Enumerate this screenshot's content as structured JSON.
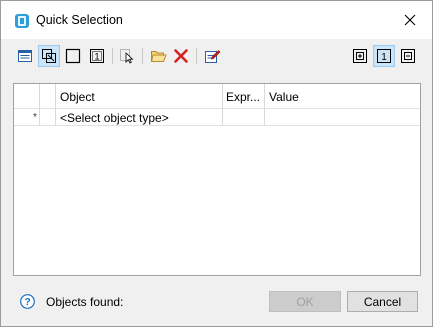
{
  "window": {
    "title": "Quick Selection"
  },
  "toolbar": {
    "buttons": [
      {
        "icon": "properties-list-icon"
      },
      {
        "icon": "select-objects-icon",
        "pressed": true
      },
      {
        "icon": "empty-square-icon"
      },
      {
        "icon": "numbered-box-icon",
        "glyph": "1"
      },
      {
        "icon": "pick-pointer-icon"
      },
      {
        "icon": "open-folder-icon"
      },
      {
        "icon": "delete-x-icon"
      },
      {
        "icon": "export-edit-icon"
      },
      {
        "icon": "expand-all-icon"
      },
      {
        "icon": "level-one-icon",
        "glyph": "1",
        "pressed": true
      },
      {
        "icon": "collapse-all-icon"
      }
    ]
  },
  "grid": {
    "columns": [
      "Object",
      "Expr...",
      "Value"
    ],
    "rows": [
      {
        "marker": "*",
        "object": "<Select object type>",
        "expr": "",
        "value": ""
      }
    ]
  },
  "footer": {
    "help_icon": "help-question-icon",
    "status_label": "Objects found:",
    "ok_label": "OK",
    "cancel_label": "Cancel"
  },
  "colors": {
    "accent_pressed": "#cce4f7",
    "delete_red": "#d42020",
    "help_blue": "#1a6fc4"
  }
}
